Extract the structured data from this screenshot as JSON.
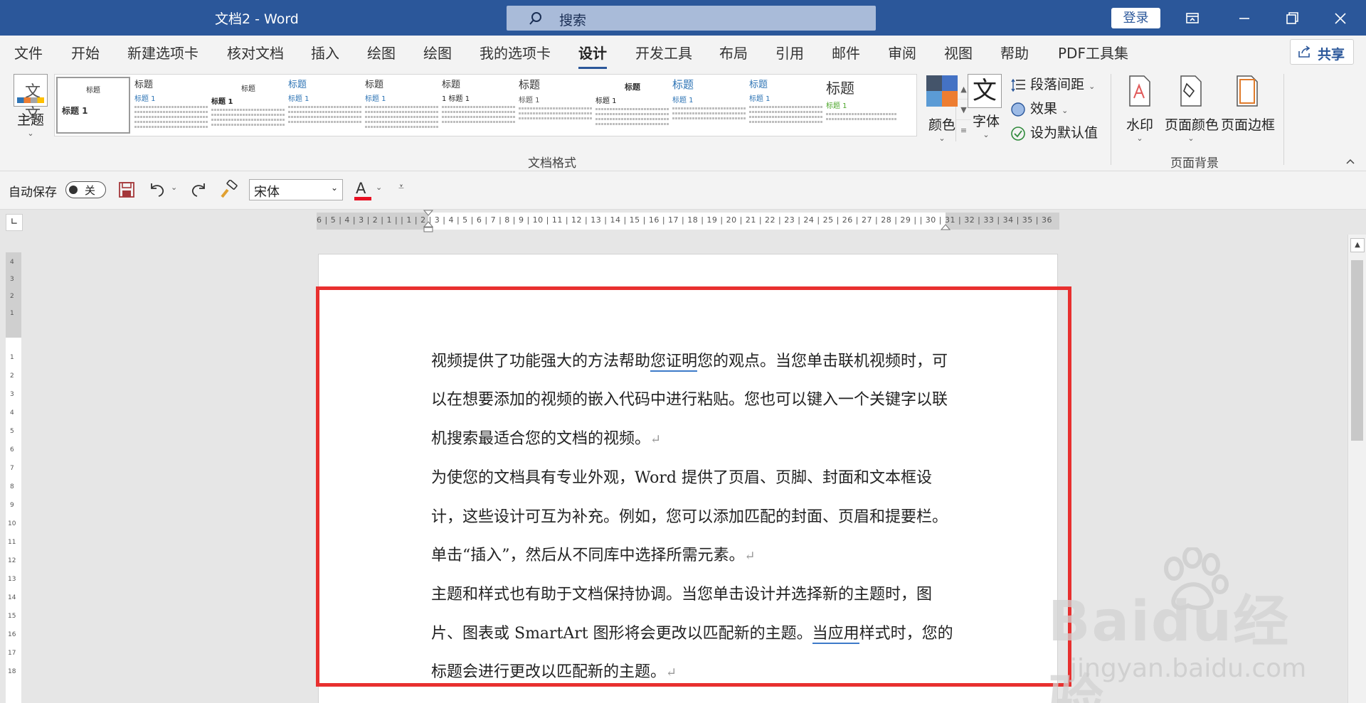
{
  "title_bar": {
    "doc_title": "文档2  -  Word",
    "search_placeholder": "搜索",
    "login": "登录"
  },
  "tabs": [
    "文件",
    "开始",
    "新建选项卡",
    "核对文档",
    "插入",
    "绘图",
    "绘图",
    "我的选项卡",
    "设计",
    "开发工具",
    "布局",
    "引用",
    "邮件",
    "审阅",
    "视图",
    "帮助",
    "PDF工具集"
  ],
  "active_tab": "设计",
  "share": "共享",
  "ribbon": {
    "theme": "主题",
    "gallery": [
      {
        "title": "标题",
        "heading": "标题 1"
      },
      {
        "title": "标题",
        "heading": "标题 1"
      },
      {
        "title": "标题",
        "heading": "标题 1"
      },
      {
        "title": "标题",
        "heading": "标题 1"
      },
      {
        "title": "标题",
        "heading": "标题 1"
      },
      {
        "title": "标题",
        "heading": "1  标题 1"
      },
      {
        "title": "标题",
        "heading": "标题 1"
      },
      {
        "title": "标题",
        "heading": "标题 1"
      },
      {
        "title": "标题",
        "heading": "标题 1"
      },
      {
        "title": "标题",
        "heading": "标题 1"
      },
      {
        "title": "标题",
        "heading": "标题 1"
      }
    ],
    "group_doc_format": "文档格式",
    "colors": "颜色",
    "fonts": "字体",
    "fonts_glyph": "文",
    "paragraph_spacing": "段落间距",
    "effects": "效果",
    "set_default": "设为默认值",
    "watermark": "水印",
    "page_color": "页面颜色",
    "page_borders": "页面边框",
    "group_page_bg": "页面背景"
  },
  "qat": {
    "autosave": "自动保存",
    "autosave_state": "关",
    "font": "宋体"
  },
  "ruler_numbers": "6 | 5 | 4 | 3 | 2 | 1 |   | 1 | 2 | 3 | 4 | 5 | 6 | 7 | 8 | 9 | 10 | 11 | 12 | 13 | 14 | 15 | 16 | 17 | 18 | 19 | 20 | 21 | 22 | 23 | 24 | 25 | 26 | 27 | 28 | 29 |   | 30 | 31 | 32 | 33 | 34 | 35 | 36",
  "document": {
    "para1": {
      "a": "视频提供了功能强大的方法帮助",
      "u": "您证明",
      "b": "您的观点。当您单击联机视频时，可以在想要添加的视频的嵌入代码中进行粘贴。您也可以键入一个关键字以联机搜索最适合您的文档的视频。"
    },
    "para2": "为使您的文档具有专业外观，Word 提供了页眉、页脚、封面和文本框设计，这些设计可互为补充。例如，您可以添加匹配的封面、页眉和提要栏。单击“插入”，然后从不同库中选择所需元素。",
    "para3": {
      "a": "主题和样式也有助于文档保持协调。当您单击设计并选择新的主题时，图片、图表或 SmartArt 图形将会更改以匹配新的主题。",
      "u": "当应用",
      "b": "样式时，您的标题会进行更改以匹配新的主题。"
    },
    "paragraph_mark": "↵"
  },
  "watermark": {
    "brand": "Baidu经验",
    "url": "jingyan.baidu.com"
  },
  "colors": {
    "title_bar": "#2b579a",
    "highlight_box": "#e8302f"
  }
}
